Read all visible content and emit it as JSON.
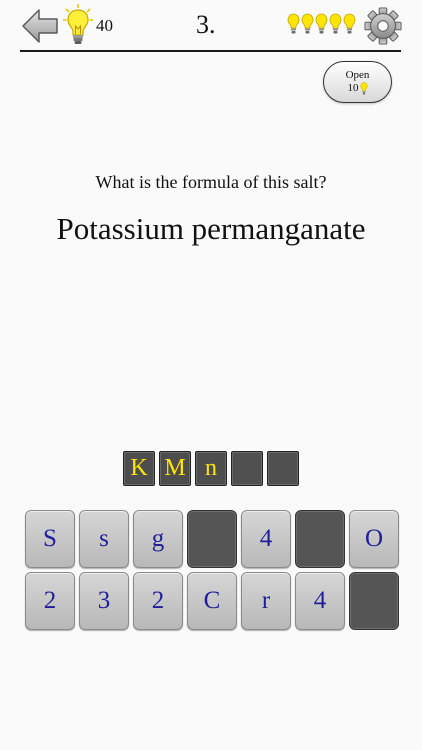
{
  "header": {
    "hint_count": "40",
    "level": "3.",
    "lives": 5,
    "accent_color": "#f5e000"
  },
  "open_button": {
    "label": "Open",
    "cost": "10"
  },
  "question": {
    "prompt": "What is the formula of this salt?",
    "name": "Potassium permanganate"
  },
  "answer_slots": [
    {
      "char": "K",
      "filled": true
    },
    {
      "char": "M",
      "filled": true
    },
    {
      "char": "n",
      "filled": true
    },
    {
      "char": "",
      "filled": false
    },
    {
      "char": "",
      "filled": false
    }
  ],
  "keyboard": {
    "row1": [
      {
        "char": "S",
        "used": false
      },
      {
        "char": "s",
        "used": false
      },
      {
        "char": "g",
        "used": false
      },
      {
        "char": "",
        "used": true
      },
      {
        "char": "4",
        "used": false
      },
      {
        "char": "",
        "used": true
      },
      {
        "char": "O",
        "used": false
      }
    ],
    "row2": [
      {
        "char": "2",
        "used": false
      },
      {
        "char": "3",
        "used": false
      },
      {
        "char": "2",
        "used": false
      },
      {
        "char": "C",
        "used": false
      },
      {
        "char": "r",
        "used": false
      },
      {
        "char": "4",
        "used": false
      },
      {
        "char": "",
        "used": true
      }
    ]
  }
}
